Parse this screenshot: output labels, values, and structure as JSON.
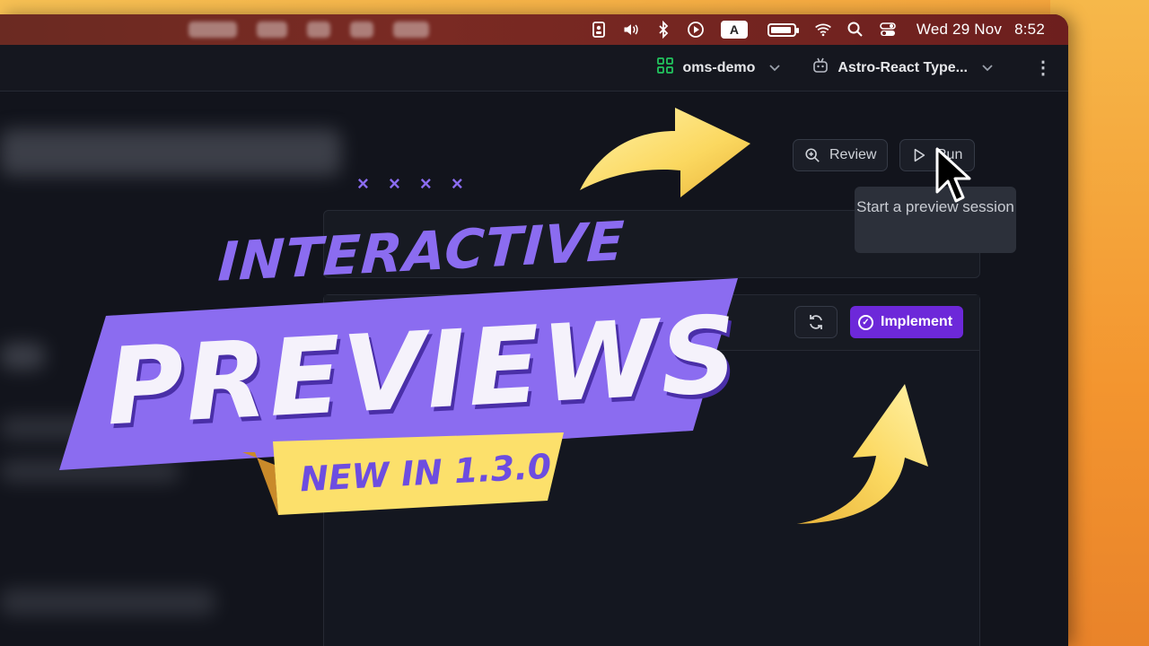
{
  "menubar": {
    "date": "Wed 29 Nov",
    "time": "8:52",
    "input_source": "A"
  },
  "app": {
    "project": "oms-demo",
    "template": "Astro-React Type..."
  },
  "toolbar": {
    "review_label": "Review",
    "run_label": "Run",
    "tooltip": "Start a preview session",
    "implement_label": "Implement"
  },
  "overlay": {
    "headline_top": "INTERACTIVE",
    "headline_main": "PREVIEWS",
    "badge": "NEW IN 1.3.0",
    "decoration": "× × × ×"
  },
  "colors": {
    "accent_purple": "#6d28d9",
    "banner_purple": "#8b6cf0",
    "tag_yellow": "#fce06b",
    "wallpaper_orange": "#f29a2e",
    "project_green": "#22c55e"
  }
}
